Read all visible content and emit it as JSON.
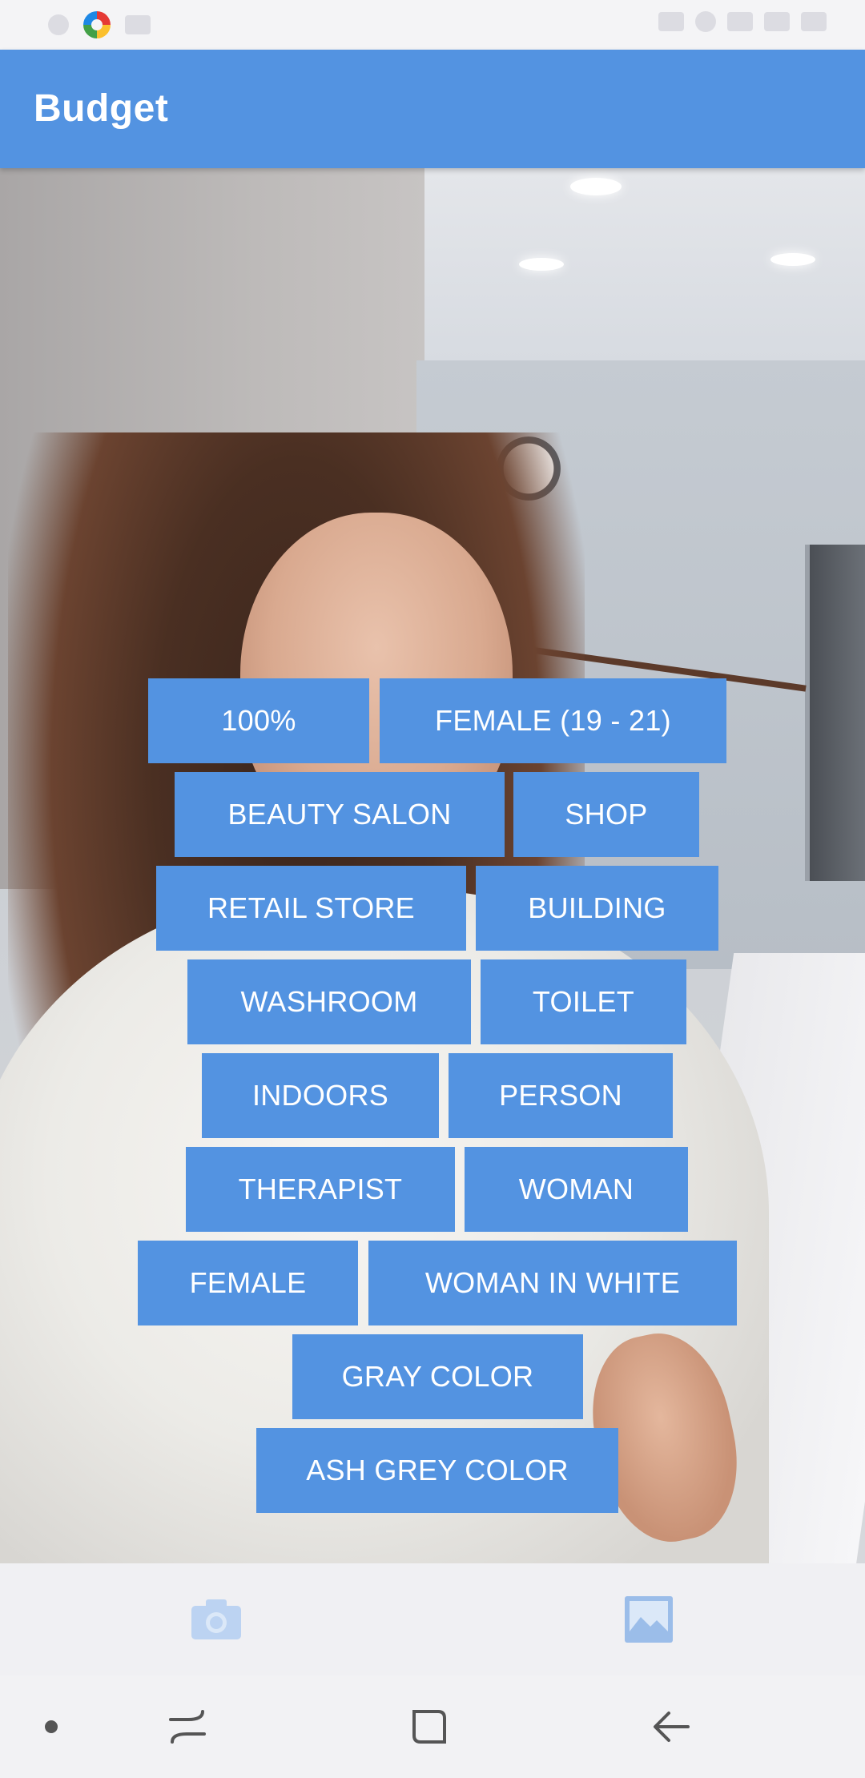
{
  "app_bar": {
    "title": "Budget"
  },
  "colors": {
    "accent": "#5393e1",
    "label_text": "#ffffff"
  },
  "tags": [
    {
      "label": "100%"
    },
    {
      "label": "FEMALE (19 - 21)"
    },
    {
      "label": "BEAUTY SALON"
    },
    {
      "label": "SHOP"
    },
    {
      "label": "RETAIL STORE"
    },
    {
      "label": "BUILDING"
    },
    {
      "label": "WASHROOM"
    },
    {
      "label": "TOILET"
    },
    {
      "label": "INDOORS"
    },
    {
      "label": "PERSON"
    },
    {
      "label": "THERAPIST"
    },
    {
      "label": "WOMAN"
    },
    {
      "label": "FEMALE"
    },
    {
      "label": "WOMAN IN WHITE"
    },
    {
      "label": "GRAY COLOR"
    },
    {
      "label": "ASH GREY COLOR"
    }
  ],
  "actions": {
    "camera_icon": "camera-icon",
    "gallery_icon": "gallery-icon"
  },
  "nav": {
    "dot": "dot-icon",
    "recents": "recents-icon",
    "home": "home-icon",
    "back": "back-icon"
  }
}
